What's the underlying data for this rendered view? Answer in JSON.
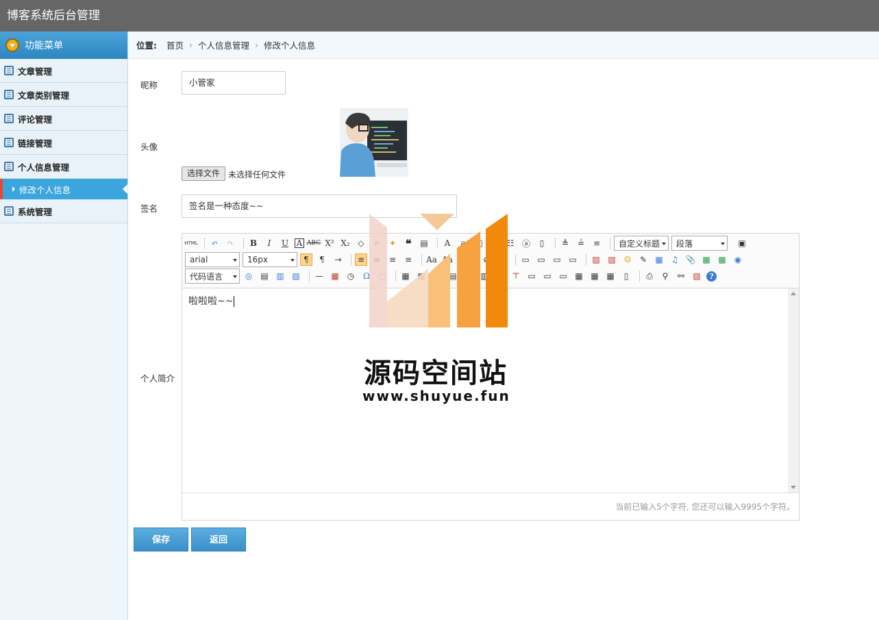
{
  "header": {
    "title": "博客系统后台管理"
  },
  "sidebar": {
    "menu_title": "功能菜单",
    "items": [
      {
        "label": "文章管理"
      },
      {
        "label": "文章类别管理"
      },
      {
        "label": "评论管理"
      },
      {
        "label": "链接管理"
      },
      {
        "label": "个人信息管理"
      },
      {
        "label": "修改个人信息"
      },
      {
        "label": "系统管理"
      }
    ]
  },
  "breadcrumb": {
    "label": "位置:",
    "items": [
      "首页",
      "个人信息管理",
      "修改个人信息"
    ]
  },
  "form": {
    "nickname_label": "昵称",
    "nickname_value": "小管家",
    "avatar_label": "头像",
    "file_button": "选择文件",
    "file_status": "未选择任何文件",
    "signature_label": "签名",
    "signature_value": "签名是一种态度~~",
    "profile_label": "个人简介"
  },
  "editor": {
    "font_family": "arial",
    "font_size": "16px",
    "custom_heading": "自定义标题",
    "paragraph": "段落",
    "code_language": "代码语言",
    "content": "啦啦啦~~",
    "footer": "当前已输入5个字符, 您还可以输入9995个字符。"
  },
  "buttons": {
    "save": "保存",
    "back": "返回"
  },
  "watermark": {
    "title": "源码空间站",
    "url": "www.shuyue.fun"
  }
}
